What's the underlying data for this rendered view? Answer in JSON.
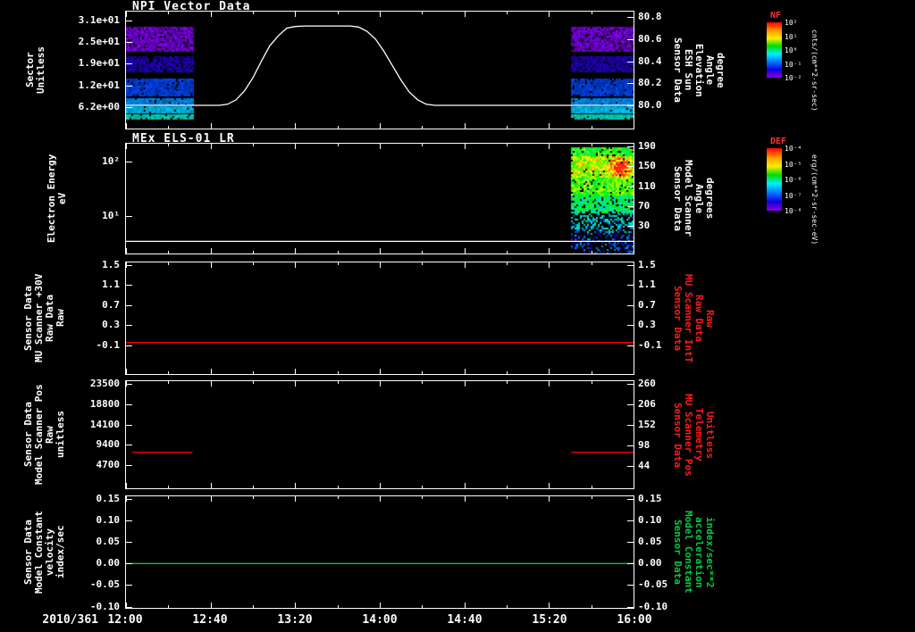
{
  "window": {
    "background": "#000000"
  },
  "x_axis": {
    "date_label": "2010/361",
    "tick_labels": [
      "12:00",
      "12:40",
      "13:20",
      "14:00",
      "14:40",
      "15:20",
      "16:00"
    ],
    "tick_minutes": [
      0,
      40,
      80,
      120,
      160,
      200,
      240
    ],
    "minutes_range": [
      0,
      240
    ]
  },
  "colorbars": [
    {
      "title": "NF",
      "title_color": "#ff3333",
      "unit": "cnts/(cm**2-sr-sec)",
      "ticks": [
        "10²",
        "10¹",
        "10⁰",
        "10⁻¹",
        "10⁻²"
      ],
      "stops": [
        "#ff0000",
        "#ff9000",
        "#ffee00",
        "#00dd00",
        "#00eeff",
        "#0077ff",
        "#1100dd",
        "#8800dd"
      ]
    },
    {
      "title": "DEF",
      "title_color": "#ff3333",
      "unit": "erg/(cm**2-sr-sec-eV)",
      "ticks": [
        "10⁻⁴",
        "10⁻⁵",
        "10⁻⁶",
        "10⁻⁷",
        "10⁻⁸"
      ],
      "stops": [
        "#ff0000",
        "#ff9000",
        "#ffee00",
        "#00dd00",
        "#00eeff",
        "#0077ff",
        "#1100dd",
        "#8800dd"
      ]
    }
  ],
  "chart_data": [
    {
      "type": "spectrogram+line",
      "title": "NPI Vector Data",
      "left_axis": {
        "label_text": "Sector\nUnitless",
        "scale": "linear",
        "ylim": [
          0,
          33.5
        ],
        "ticks": [
          "3.1e+01",
          "2.5e+01",
          "1.9e+01",
          "1.2e+01",
          "6.2e+00"
        ],
        "tick_values": [
          31,
          24.8,
          18.6,
          12.4,
          6.2
        ]
      },
      "right_axis": {
        "label_text": "Sensor Data\nESH Sun\nElevation\nAngle\ndegree",
        "scale": "linear",
        "ylim": [
          79.79,
          80.85
        ],
        "label_color": "#ffffff",
        "ticks": [
          "80.8",
          "80.6",
          "80.4",
          "80.2",
          "80.0"
        ],
        "tick_values": [
          80.8,
          80.6,
          80.4,
          80.2,
          80.0
        ]
      },
      "series": [
        {
          "name": "esh-sun-elevation",
          "axis": "right",
          "color": "#ffffff",
          "points": [
            [
              0,
              80
            ],
            [
              44,
              80
            ],
            [
              48,
              80.01
            ],
            [
              52,
              80.05
            ],
            [
              56,
              80.13
            ],
            [
              60,
              80.25
            ],
            [
              64,
              80.4
            ],
            [
              68,
              80.54
            ],
            [
              72,
              80.63
            ],
            [
              76,
              80.7
            ],
            [
              80,
              80.715
            ],
            [
              84,
              80.72
            ],
            [
              106,
              80.72
            ],
            [
              110,
              80.71
            ],
            [
              114,
              80.67
            ],
            [
              118,
              80.6
            ],
            [
              122,
              80.49
            ],
            [
              126,
              80.36
            ],
            [
              130,
              80.23
            ],
            [
              134,
              80.12
            ],
            [
              138,
              80.05
            ],
            [
              142,
              80.01
            ],
            [
              146,
              80
            ],
            [
              240,
              80
            ]
          ]
        }
      ],
      "spectrogram": {
        "blocks": [
          {
            "t0": 0,
            "t1": 31.5
          },
          {
            "t0": 210.5,
            "t1": 240
          }
        ],
        "bands": [
          {
            "f0": 0.128,
            "f1": 0.346,
            "color": "#8800ff",
            "noise": 0.55,
            "density": 0.92
          },
          {
            "f0": 0.383,
            "f1": 0.511,
            "color": "#2200cc",
            "noise": 0.5,
            "density": 0.88
          },
          {
            "f0": 0.571,
            "f1": 0.729,
            "color": "#0048ff",
            "noise": 0.45,
            "density": 0.92
          },
          {
            "f0": 0.744,
            "f1": 0.797,
            "color": "#0092ff",
            "noise": 0.35,
            "density": 0.95
          },
          {
            "f0": 0.812,
            "f1": 0.865,
            "color": "#00c8ff",
            "noise": 0.3,
            "density": 0.95
          },
          {
            "f0": 0.88,
            "f1": 0.925,
            "color": "#00e0c0",
            "noise": 0.3,
            "density": 0.9
          }
        ]
      }
    },
    {
      "type": "spectrogram+line",
      "title": "MEx ELS-01 LR",
      "left_axis": {
        "label_text": "Electron Energy\neV",
        "scale": "log",
        "ylim": [
          2.1,
          210
        ],
        "ticks": [
          "10²",
          "10¹"
        ],
        "tick_values": [
          100,
          10
        ]
      },
      "right_axis": {
        "label_text": "Sensor Data\nModel Scanner\nAngle\ndegrees",
        "scale": "linear",
        "ylim": [
          -25,
          195
        ],
        "label_color": "#ffffff",
        "ticks": [
          "190",
          "150",
          "110",
          "70",
          "30"
        ],
        "tick_values": [
          190,
          150,
          110,
          70,
          30
        ]
      },
      "series": [
        {
          "name": "baseline-energy",
          "axis": "left",
          "color": "#ffffff",
          "points": [
            [
              0,
              3.5
            ],
            [
              240,
              3.5
            ]
          ]
        }
      ],
      "spectrogram": {
        "block": {
          "t0": 210.5,
          "t1": 240
        },
        "segments": [
          {
            "f0": 0.03,
            "f1": 0.1,
            "v": 0.55,
            "spread": 0.15,
            "density": 0.9
          },
          {
            "f0": 0.1,
            "f1": 0.3,
            "v": 0.72,
            "spread": 0.16,
            "density": 0.95
          },
          {
            "f0": 0.3,
            "f1": 0.46,
            "v": 0.6,
            "spread": 0.15,
            "density": 0.9
          },
          {
            "f0": 0.46,
            "f1": 0.62,
            "v": 0.45,
            "spread": 0.15,
            "density": 0.8
          },
          {
            "f0": 0.62,
            "f1": 0.8,
            "v": 0.3,
            "spread": 0.14,
            "density": 0.5
          },
          {
            "f0": 0.8,
            "f1": 1.0,
            "v": 0.17,
            "spread": 0.12,
            "density": 0.35
          }
        ],
        "hotspot": {
          "x0": 0.55,
          "x1": 1.0,
          "f0": 0.08,
          "f1": 0.34,
          "boost": 0.38
        }
      }
    },
    {
      "type": "line",
      "title": "",
      "left_axis": {
        "label_text": "Sensor Data\nMU Scanner +30V\nRaw Data\nRaw",
        "scale": "linear",
        "ylim": [
          -0.68,
          1.554
        ],
        "ticks": [
          "1.5",
          "1.1",
          "0.7",
          "0.3",
          "-0.1"
        ],
        "tick_values": [
          1.5,
          1.1,
          0.7,
          0.3,
          -0.1
        ]
      },
      "right_axis": {
        "label_text": "Sensor Data\nMU Scanner IntT\nRaw Data\nRaw",
        "scale": "linear",
        "ylim": [
          -0.68,
          1.554
        ],
        "label_color": "#ff1a1a",
        "ticks": [
          "1.5",
          "1.1",
          "0.7",
          "0.3",
          "-0.1"
        ],
        "tick_values": [
          1.5,
          1.1,
          0.7,
          0.3,
          -0.1
        ]
      },
      "series": [
        {
          "name": "mu-scanner-30v-raw",
          "axis": "left",
          "color": "#ff0000",
          "points": [
            [
              0,
              -0.05
            ],
            [
              240,
              -0.05
            ]
          ]
        }
      ],
      "spectrogram": null
    },
    {
      "type": "line",
      "title": "",
      "left_axis": {
        "label_text": "Sensor Data\nModel Scanner Pos\nRaw\nunitless",
        "scale": "linear",
        "ylim": [
          -620,
          24118
        ],
        "ticks": [
          "23500",
          "18800",
          "14100",
          "9400",
          "4700"
        ],
        "tick_values": [
          23500,
          18800,
          14100,
          9400,
          4700
        ]
      },
      "right_axis": {
        "label_text": "Sensor Data\nMU Scanner Pos\nTelemetry\nUnitless",
        "scale": "linear",
        "ylim": [
          -13.5,
          267
        ],
        "label_color": "#ff1a1a",
        "ticks": [
          "260",
          "206",
          "152",
          "98",
          "44"
        ],
        "tick_values": [
          260,
          206,
          152,
          98,
          44
        ]
      },
      "series": [
        {
          "name": "scanner-pos-segment-1",
          "axis": "left",
          "color": "#ff0000",
          "points": [
            [
              3,
              7700
            ],
            [
              31.5,
              7700
            ]
          ]
        },
        {
          "name": "scanner-pos-segment-2",
          "axis": "left",
          "color": "#ff0000",
          "points": [
            [
              210.5,
              7700
            ],
            [
              240,
              7700
            ]
          ]
        }
      ],
      "spectrogram": null
    },
    {
      "type": "line",
      "title": "",
      "left_axis": {
        "label_text": "Sensor Data\nModel Constant\nvelocity\nindex/sec",
        "scale": "linear",
        "ylim": [
          -0.103,
          0.156
        ],
        "ticks": [
          "0.15",
          "0.10",
          "0.05",
          "0.00",
          "-0.05",
          "-0.10"
        ],
        "tick_values": [
          0.15,
          0.1,
          0.05,
          0,
          -0.05,
          -0.1
        ]
      },
      "right_axis": {
        "label_text": "Sensor Data\nModel Constant\nacceleration\nindex/sec**2",
        "scale": "linear",
        "ylim": [
          -0.103,
          0.156
        ],
        "label_color": "#00cc44",
        "ticks": [
          "0.15",
          "0.10",
          "0.05",
          "0.00",
          "-0.05",
          "-0.10"
        ],
        "tick_values": [
          0.15,
          0.1,
          0.05,
          0,
          -0.05,
          -0.1
        ]
      },
      "series": [
        {
          "name": "model-constant-velocity",
          "axis": "left",
          "color": "#00c83c",
          "points": [
            [
              0,
              0
            ],
            [
              240,
              0
            ]
          ]
        }
      ],
      "spectrogram": null
    }
  ]
}
